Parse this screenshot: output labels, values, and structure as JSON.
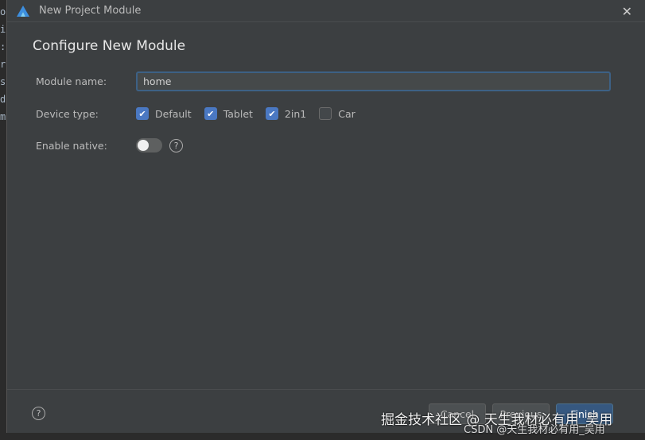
{
  "editor_chars": [
    "o",
    "i",
    ":",
    "r",
    "s",
    "d",
    "m"
  ],
  "dialog": {
    "title": "New Project Module",
    "heading": "Configure New Module",
    "module_name": {
      "label": "Module name:",
      "value": "home"
    },
    "device_type": {
      "label": "Device type:",
      "options": [
        {
          "label": "Default",
          "checked": true
        },
        {
          "label": "Tablet",
          "checked": true
        },
        {
          "label": "2in1",
          "checked": true
        },
        {
          "label": "Car",
          "checked": false
        }
      ]
    },
    "enable_native": {
      "label": "Enable native:",
      "on": false
    },
    "buttons": {
      "cancel": "Cancel",
      "previous": "Previous",
      "finish": "Finish"
    }
  },
  "watermarks": [
    "掘金技术社区 @ 天生我材必有用_吴用",
    "CSDN @天生我材必有用_吴用"
  ],
  "colors": {
    "accent": "#4a78c2",
    "primary_button": "#365880",
    "dialog_bg": "#3c3f41"
  }
}
